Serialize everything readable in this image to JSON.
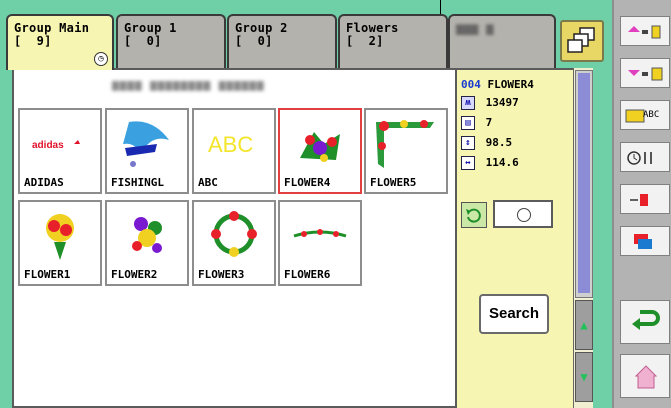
{
  "tabs": [
    {
      "line1": "Group Main",
      "line2": "[  9]",
      "active": true
    },
    {
      "line1": "Group 1",
      "line2": "[  0]",
      "active": false
    },
    {
      "line1": "Group 2",
      "line2": "[  0]",
      "active": false
    },
    {
      "line1": "Flowers",
      "line2": "[  2]",
      "active": false
    },
    {
      "line1": "",
      "line2": "",
      "active": false,
      "blurred": true
    }
  ],
  "main": {
    "designs": [
      {
        "name": "ADIDAS",
        "selected": false,
        "art": "adidas-icon"
      },
      {
        "name": "FISHINGL",
        "selected": false,
        "art": "fish-icon"
      },
      {
        "name": "ABC",
        "selected": false,
        "art": "abc-icon"
      },
      {
        "name": "FLOWER4",
        "selected": true,
        "art": "flower-bouquet-icon"
      },
      {
        "name": "FLOWER5",
        "selected": false,
        "art": "flower-corner-icon"
      },
      {
        "name": "FLOWER1",
        "selected": false,
        "art": "flower-bunch-icon"
      },
      {
        "name": "FLOWER2",
        "selected": false,
        "art": "flower-cluster-icon"
      },
      {
        "name": "FLOWER3",
        "selected": false,
        "art": "flower-wreath-icon"
      },
      {
        "name": "FLOWER6",
        "selected": false,
        "art": "flower-garland-icon"
      }
    ]
  },
  "info": {
    "number": "004",
    "name": "FLOWER4",
    "stitches": "13497",
    "colors": "7",
    "height": "98.5",
    "width": "114.6",
    "search_label": "Search"
  },
  "toolbar": {
    "abc_label": "ABC"
  },
  "colors": {
    "background": "#6fd0a8",
    "active_tab": "#f7f5b2",
    "selected_border": "#e24040",
    "info_panel": "#f7f5b2",
    "toolbar": "#b3b3b3"
  }
}
